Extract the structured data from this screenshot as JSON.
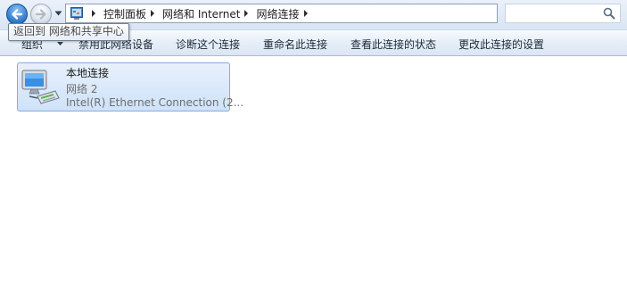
{
  "tooltip": {
    "text": "返回到 网络和共享中心"
  },
  "address": {
    "crumbs": [
      "控制面板",
      "网络和 Internet",
      "网络连接"
    ]
  },
  "toolbar": {
    "organize": "组织",
    "commands": [
      "禁用此网络设备",
      "诊断这个连接",
      "重命名此连接",
      "查看此连接的状态",
      "更改此连接的设置"
    ]
  },
  "connection": {
    "name": "本地连接",
    "network": "网络  2",
    "device": "Intel(R) Ethernet Connection (2..."
  },
  "icons": {
    "back": "back-arrow-icon",
    "forward": "forward-arrow-icon",
    "history": "chevron-down-icon",
    "location": "control-panel-icon",
    "separator": "breadcrumb-arrow-icon",
    "search": "search-icon",
    "connection": "network-adapter-icon"
  }
}
